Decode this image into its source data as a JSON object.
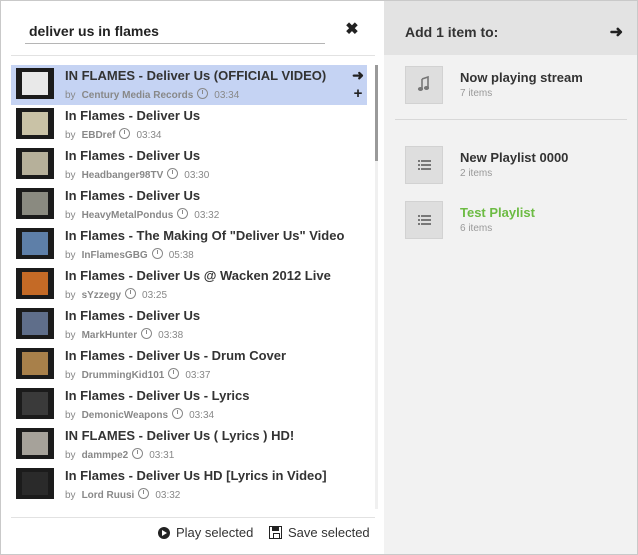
{
  "search": {
    "value": "deliver us in flames",
    "clear_label": "✖"
  },
  "results": [
    {
      "title": "IN FLAMES - Deliver Us (OFFICIAL VIDEO)",
      "by": "by",
      "uploader": "Century Media Records",
      "duration": "03:34",
      "selected": true,
      "thumb_color": "#e9e9e9"
    },
    {
      "title": "In Flames - Deliver Us",
      "by": "by",
      "uploader": "EBDref",
      "duration": "03:34",
      "thumb_color": "#c9c2a6"
    },
    {
      "title": "In Flames - Deliver Us",
      "by": "by",
      "uploader": "Headbanger98TV",
      "duration": "03:30",
      "thumb_color": "#b6b09a"
    },
    {
      "title": "In Flames - Deliver Us",
      "by": "by",
      "uploader": "HeavyMetalPondus",
      "duration": "03:32",
      "thumb_color": "#8a8a80"
    },
    {
      "title": "In Flames - The Making Of \"Deliver Us\" Video",
      "by": "by",
      "uploader": "InFlamesGBG",
      "duration": "05:38",
      "thumb_color": "#5e7fa8"
    },
    {
      "title": "In Flames - Deliver Us @ Wacken 2012 Live",
      "by": "by",
      "uploader": "sYzzegy",
      "duration": "03:25",
      "thumb_color": "#c46a26"
    },
    {
      "title": "In Flames - Deliver Us",
      "by": "by",
      "uploader": "MarkHunter",
      "duration": "03:38",
      "thumb_color": "#5f6e8a"
    },
    {
      "title": "In Flames - Deliver Us - Drum Cover",
      "by": "by",
      "uploader": "DrummingKid101",
      "duration": "03:37",
      "thumb_color": "#a8804a"
    },
    {
      "title": "In Flames - Deliver Us - Lyrics",
      "by": "by",
      "uploader": "DemonicWeapons",
      "duration": "03:34",
      "thumb_color": "#3a3a3a"
    },
    {
      "title": "IN FLAMES - Deliver Us ( Lyrics ) HD!",
      "by": "by",
      "uploader": "dammpe2",
      "duration": "03:31",
      "thumb_color": "#a6a29a"
    },
    {
      "title": "In Flames - Deliver Us HD [Lyrics in Video]",
      "by": "by",
      "uploader": "Lord Ruusi",
      "duration": "03:32",
      "thumb_color": "#2a2a2a"
    }
  ],
  "row_actions": {
    "arrow": "➜",
    "plus": "+"
  },
  "footer": {
    "play_label": "Play selected",
    "save_label": "Save selected"
  },
  "panel": {
    "title": "Add 1 item to:",
    "arrow": "➜",
    "targets": [
      {
        "name": "Now playing stream",
        "count": "7 items",
        "icon": "music-note-icon"
      },
      {
        "name": "New Playlist 0000",
        "count": "2 items",
        "icon": "list-icon"
      },
      {
        "name": "Test Playlist",
        "count": "6 items",
        "icon": "list-icon",
        "accent": true
      }
    ]
  },
  "colors": {
    "selected_row": "#c5d3f3",
    "accent_green": "#6cbb43",
    "panel_bg": "#f2f2f2"
  }
}
